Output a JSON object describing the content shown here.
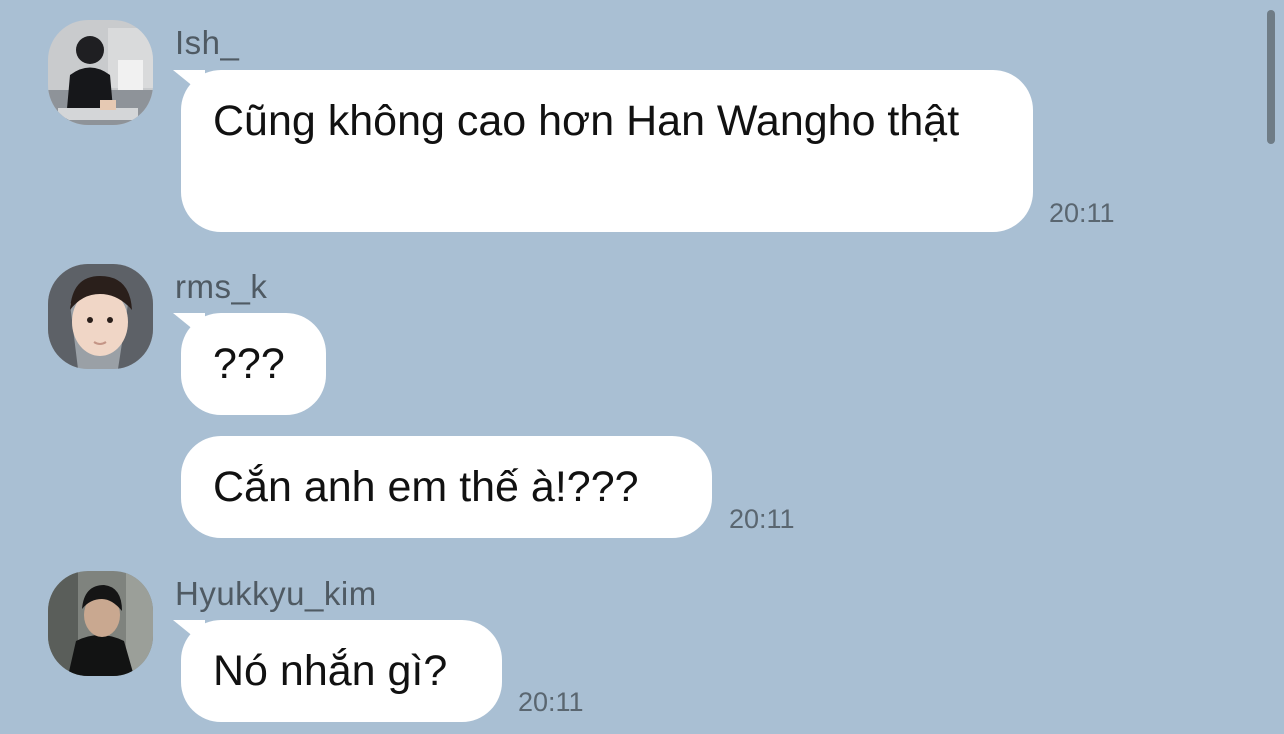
{
  "messages": [
    {
      "sender": "Ish_",
      "text": "Cũng không cao hơn Han Wangho thật",
      "time": "20:11"
    },
    {
      "sender": "rms_k",
      "text": "???",
      "time": ""
    },
    {
      "sender": "",
      "text": "Cắn anh em thế à!???",
      "time": "20:11"
    },
    {
      "sender": "Hyukkyu_kim",
      "text": "Nó nhắn gì?",
      "time": "20:11"
    }
  ],
  "colors": {
    "background": "#a9bfd3",
    "bubble": "#ffffff",
    "sender_text": "#4f5a63",
    "time_text": "#5a6670"
  },
  "icons": [
    "avatar-ish",
    "avatar-rms-k",
    "avatar-hyukkyu-kim"
  ]
}
